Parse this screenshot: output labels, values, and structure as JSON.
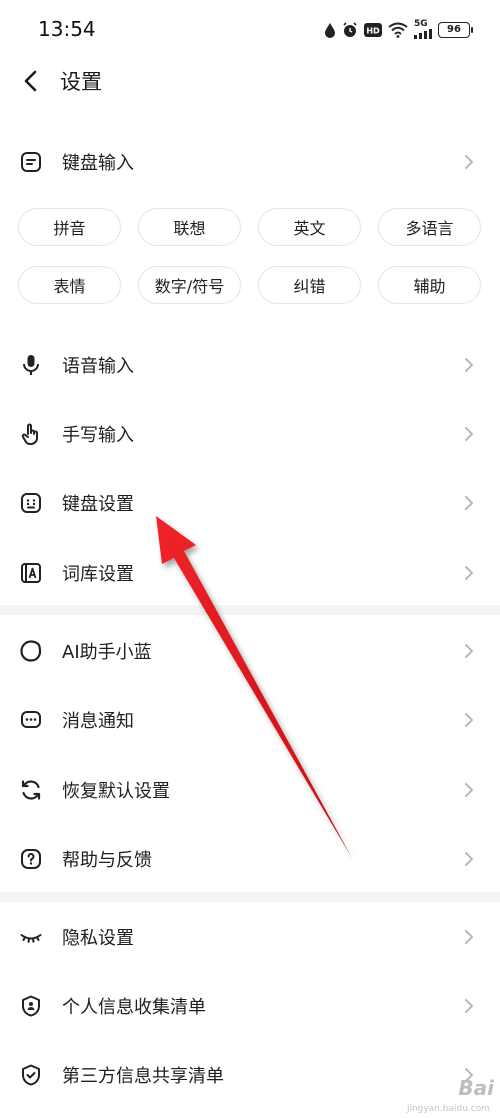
{
  "status_bar": {
    "time": "13:54",
    "network": "5G",
    "battery": "96"
  },
  "header": {
    "title": "设置"
  },
  "keyboard_input": {
    "label": "键盘输入",
    "chips": [
      "拼音",
      "联想",
      "英文",
      "多语言",
      "表情",
      "数字/符号",
      "纠错",
      "辅助"
    ]
  },
  "group1": [
    {
      "label": "语音输入",
      "icon": "microphone-icon"
    },
    {
      "label": "手写输入",
      "icon": "hand-pointer-icon"
    },
    {
      "label": "键盘设置",
      "icon": "keyboard-icon"
    },
    {
      "label": "词库设置",
      "icon": "dictionary-icon"
    }
  ],
  "group2": [
    {
      "label": "AI助手小蓝",
      "icon": "ai-assistant-icon"
    },
    {
      "label": "消息通知",
      "icon": "message-icon"
    },
    {
      "label": "恢复默认设置",
      "icon": "reset-icon"
    },
    {
      "label": "帮助与反馈",
      "icon": "help-icon"
    }
  ],
  "group3": [
    {
      "label": "隐私设置",
      "icon": "eye-closed-icon"
    },
    {
      "label": "个人信息收集清单",
      "icon": "personal-info-icon"
    },
    {
      "label": "第三方信息共享清单",
      "icon": "shield-check-icon"
    }
  ],
  "watermark": {
    "text": "Bai",
    "sub": "jingyan.baidu.com"
  },
  "colors": {
    "annotation_arrow": "#e8141b",
    "divider": "#f4f4f6",
    "chevron": "#b8b8b8"
  }
}
